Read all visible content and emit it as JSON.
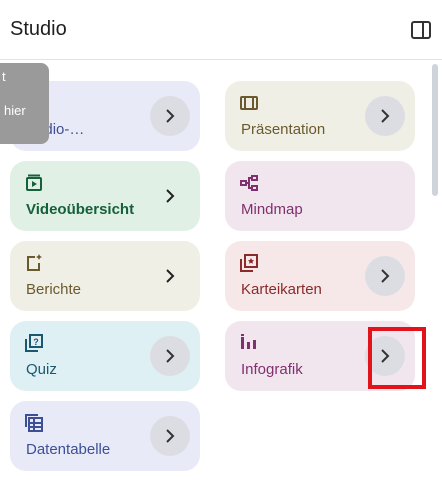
{
  "header": {
    "title": "Studio",
    "panel_toggle_icon": "dock-panel-icon"
  },
  "tooltip": {
    "line1": "t",
    "line2": "hier"
  },
  "cards": {
    "audio": {
      "label": "Audio-…",
      "icon": "audio-waveform-sparkle-icon",
      "color": "#3d4f95"
    },
    "praes": {
      "label": "Präsentation",
      "icon": "slides-icon",
      "color": "#6b5a2e"
    },
    "video": {
      "label": "Videoübersicht",
      "icon": "video-play-icon",
      "color": "#16613a"
    },
    "mind": {
      "label": "Mindmap",
      "icon": "mindmap-icon",
      "color": "#80306e"
    },
    "ber": {
      "label": "Berichte",
      "icon": "report-sparkle-icon",
      "color": "#6b5a2e"
    },
    "kart": {
      "label": "Karteikarten",
      "icon": "flashcards-icon",
      "color": "#8a2b2b"
    },
    "quiz": {
      "label": "Quiz",
      "icon": "quiz-icon",
      "color": "#1a5870"
    },
    "info": {
      "label": "Infografik",
      "icon": "infographic-bars-icon",
      "color": "#80306e"
    },
    "daten": {
      "label": "Datentabelle",
      "icon": "data-table-icon",
      "color": "#3d4f95"
    }
  },
  "highlight_color": "#e3131b"
}
